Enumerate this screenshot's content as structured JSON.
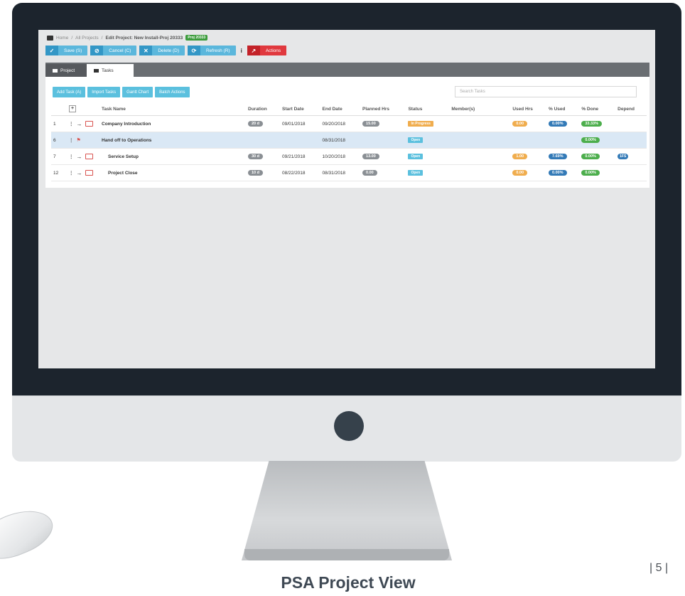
{
  "breadcrumb": {
    "home": "Home",
    "sep1": "/",
    "all_projects": "All Projects",
    "sep2": "/",
    "current": "Edit Project: New Install-Proj 20333",
    "badge": "Proj 20333"
  },
  "toolbar": {
    "save": "Save (S)",
    "cancel": "Cancel (C)",
    "delete": "Delete (D)",
    "refresh": "Refresh (R)",
    "info": "i",
    "actions": "Actions"
  },
  "tabs": [
    {
      "label": "Project",
      "active": false
    },
    {
      "label": "Tasks",
      "active": true
    }
  ],
  "task_actions": {
    "add": "Add Task (A)",
    "import": "Import Tasks",
    "gantt": "Gantt Chart",
    "batch": "Batch Actions"
  },
  "search": {
    "placeholder": "Search Tasks"
  },
  "columns": {
    "expand": "+",
    "name": "Task Name",
    "duration": "Duration",
    "start": "Start Date",
    "end": "End Date",
    "planned": "Planned Hrs",
    "status": "Status",
    "members": "Member(s)",
    "used": "Used Hrs",
    "pct_used": "% Used",
    "pct_done": "% Done",
    "depend": "Depend"
  },
  "tasks": [
    {
      "num": "1",
      "name": "Company Introduction",
      "duration": "20 d",
      "start": "09/01/2018",
      "end": "09/20/2018",
      "planned": "15.00",
      "status": "In Progress",
      "used": "0.00",
      "pct_used": "0.00%",
      "pct_done": "33.33%",
      "depend": ""
    },
    {
      "num": "6",
      "name": "Hand off to Operations",
      "duration": "",
      "start": "",
      "end": "08/31/2018",
      "planned": "",
      "status": "Open",
      "used": "",
      "pct_used": "",
      "pct_done": "0.00%",
      "depend": ""
    },
    {
      "num": "7",
      "name": "Service Setup",
      "duration": "30 d",
      "start": "09/21/2018",
      "end": "10/20/2018",
      "planned": "13.00",
      "status": "Open",
      "used": "1.00",
      "pct_used": "7.69%",
      "pct_done": "0.00%",
      "depend": "1FS"
    },
    {
      "num": "12",
      "name": "Project Close",
      "duration": "10 d",
      "start": "08/22/2018",
      "end": "08/31/2018",
      "planned": "0.00",
      "status": "Open",
      "used": "0.00",
      "pct_used": "0.00%",
      "pct_done": "0.00%",
      "depend": ""
    }
  ],
  "caption": "PSA Project View",
  "page_number": "| 5 |"
}
